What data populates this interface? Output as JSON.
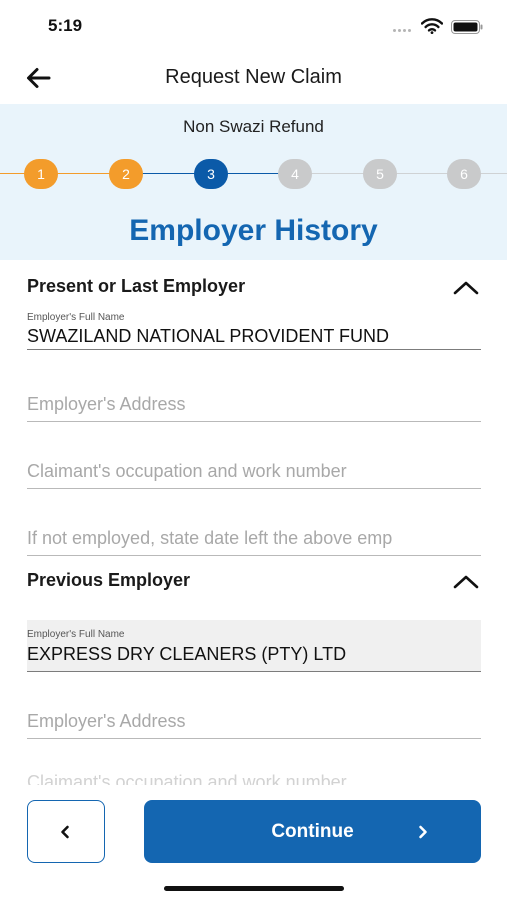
{
  "status_bar": {
    "time": "5:19"
  },
  "header": {
    "title": "Request New Claim"
  },
  "progress": {
    "claim_type": "Non Swazi Refund",
    "steps": [
      "1",
      "2",
      "3",
      "4",
      "5",
      "6"
    ],
    "current_step": 3,
    "section_title": "Employer History",
    "colors": {
      "done": "#f39c2b",
      "current": "#0b5aa8",
      "todo": "#c9cacb"
    }
  },
  "present_employer": {
    "title": "Present or Last Employer",
    "name_label": "Employer's Full Name",
    "name_value": "SWAZILAND NATIONAL PROVIDENT FUND",
    "address_placeholder": "Employer's Address",
    "occupation_placeholder": "Claimant's occupation and work number",
    "date_left_placeholder": "If not employed, state date left the above emp"
  },
  "previous_employer": {
    "title": "Previous Employer",
    "name_label": "Employer's Full Name",
    "name_value": "EXPRESS DRY CLEANERS (PTY) LTD",
    "address_placeholder": "Employer's Address",
    "occupation_placeholder": "Claimant's occupation and work number"
  },
  "footer": {
    "continue_label": "Continue"
  },
  "colors": {
    "accent": "#1466b1",
    "panel": "#e9f4fb"
  }
}
